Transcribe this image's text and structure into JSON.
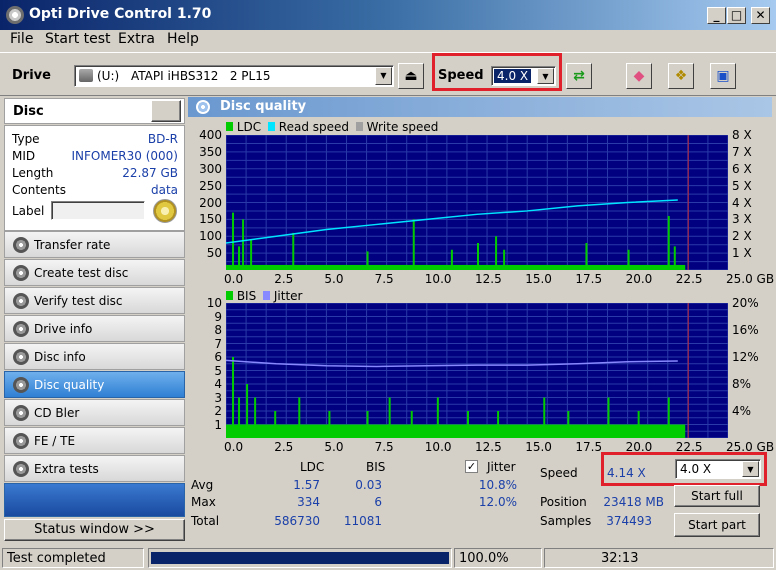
{
  "window": {
    "title": "Opti Drive Control 1.70"
  },
  "menu": [
    "File",
    "Start test",
    "Extra",
    "Help"
  ],
  "toolbar": {
    "drive_label": "Drive",
    "drive_letter": "(U:)",
    "drive_name": "ATAPI iHBS312   2 PL15",
    "speed_label": "Speed",
    "speed_value": "4.0 X"
  },
  "disc": {
    "header": "Disc",
    "fields": [
      {
        "key": "Type",
        "value": "BD-R"
      },
      {
        "key": "MID",
        "value": "INFOMER30 (000)"
      },
      {
        "key": "Length",
        "value": "22.87 GB"
      },
      {
        "key": "Contents",
        "value": "data"
      }
    ],
    "label_key": "Label"
  },
  "sidebar": {
    "items": [
      {
        "label": "Transfer rate"
      },
      {
        "label": "Create test disc"
      },
      {
        "label": "Verify test disc"
      },
      {
        "label": "Drive info"
      },
      {
        "label": "Disc info"
      },
      {
        "label": "Disc quality"
      },
      {
        "label": "CD Bler"
      },
      {
        "label": "FE / TE"
      },
      {
        "label": "Extra tests"
      }
    ],
    "active_index": 5,
    "status_window_button": "Status window >>"
  },
  "panel": {
    "title": "Disc quality"
  },
  "chart_data": [
    {
      "type": "bar",
      "legend": [
        "LDC",
        "Read speed",
        "Write speed"
      ],
      "legend_colors": [
        "#00cc00",
        "#00e5ff",
        "#a0a0a0"
      ],
      "ylim": [
        0,
        400
      ],
      "yticks": [
        "400",
        "350",
        "300",
        "250",
        "200",
        "150",
        "100",
        "50"
      ],
      "y2ticks": [
        "8 X",
        "7 X",
        "6 X",
        "5 X",
        "4 X",
        "3 X",
        "2 X",
        "1 X"
      ],
      "xticks": [
        "0.0",
        "2.5",
        "5.0",
        "7.5",
        "10.0",
        "12.5",
        "15.0",
        "17.5",
        "20.0",
        "22.5",
        "25.0 GB"
      ],
      "xlim": [
        0,
        25
      ],
      "read_speed": {
        "x": [
          0,
          2.5,
          5,
          7.5,
          10,
          12.5,
          15,
          17.5,
          20,
          22.5
        ],
        "y": [
          1.6,
          2.0,
          2.4,
          2.7,
          3.0,
          3.3,
          3.5,
          3.8,
          4.0,
          4.15
        ]
      },
      "ldc_spikes": {
        "x": [
          0.3,
          0.6,
          0.8,
          1.2,
          3.3,
          7.0,
          9.3,
          11.2,
          12.5,
          13.4,
          13.8,
          17.9,
          20.0,
          22.0,
          22.3
        ],
        "y": [
          170,
          70,
          150,
          90,
          110,
          55,
          150,
          60,
          80,
          100,
          60,
          80,
          60,
          160,
          70
        ]
      },
      "ldc_baseline": 15
    },
    {
      "type": "bar",
      "legend": [
        "BIS",
        "Jitter"
      ],
      "legend_colors": [
        "#00cc00",
        "#8888ff"
      ],
      "ylim": [
        0,
        10
      ],
      "yticks": [
        "10",
        "9",
        "8",
        "7",
        "6",
        "5",
        "4",
        "3",
        "2",
        "1"
      ],
      "y2ticks": [
        "20%",
        "16%",
        "12%",
        "8%",
        "4%"
      ],
      "xticks": [
        "0.0",
        "2.5",
        "5.0",
        "7.5",
        "10.0",
        "12.5",
        "15.0",
        "17.5",
        "20.0",
        "22.5",
        "25.0 GB"
      ],
      "xlim": [
        0,
        25
      ],
      "jitter": {
        "x": [
          0,
          2.5,
          5,
          7.5,
          10,
          12.5,
          15,
          17.5,
          20,
          22.5
        ],
        "y": [
          11.5,
          11.0,
          10.7,
          10.6,
          10.7,
          10.8,
          10.8,
          11.0,
          11.3,
          11.4
        ]
      },
      "bis_spikes": {
        "x": [
          0.3,
          0.6,
          1.0,
          1.4,
          2.4,
          3.6,
          5.1,
          7.0,
          8.1,
          9.2,
          10.5,
          12.0,
          13.5,
          15.8,
          17.0,
          19.0,
          20.5,
          22.0
        ],
        "y": [
          6,
          3,
          4,
          3,
          2,
          3,
          2,
          2,
          3,
          2,
          3,
          2,
          2,
          3,
          2,
          3,
          2,
          3
        ]
      },
      "bis_baseline": 1
    }
  ],
  "stats": {
    "col_ldc": "LDC",
    "col_bis": "BIS",
    "jitter_label": "Jitter",
    "rows": [
      {
        "label": "Avg",
        "ldc": "1.57",
        "bis": "0.03",
        "jitter": "10.8%"
      },
      {
        "label": "Max",
        "ldc": "334",
        "bis": "6",
        "jitter": "12.0%"
      },
      {
        "label": "Total",
        "ldc": "586730",
        "bis": "11081",
        "jitter": ""
      }
    ],
    "speed_label": "Speed",
    "speed_value": "4.14 X",
    "speed_select": "4.0 X",
    "position_label": "Position",
    "position_value": "23418 MB",
    "samples_label": "Samples",
    "samples_value": "374493",
    "start_full": "Start full",
    "start_part": "Start part"
  },
  "status": {
    "text": "Test completed",
    "progress_percent": "100.0%",
    "progress": 1.0,
    "time": "32:13"
  }
}
